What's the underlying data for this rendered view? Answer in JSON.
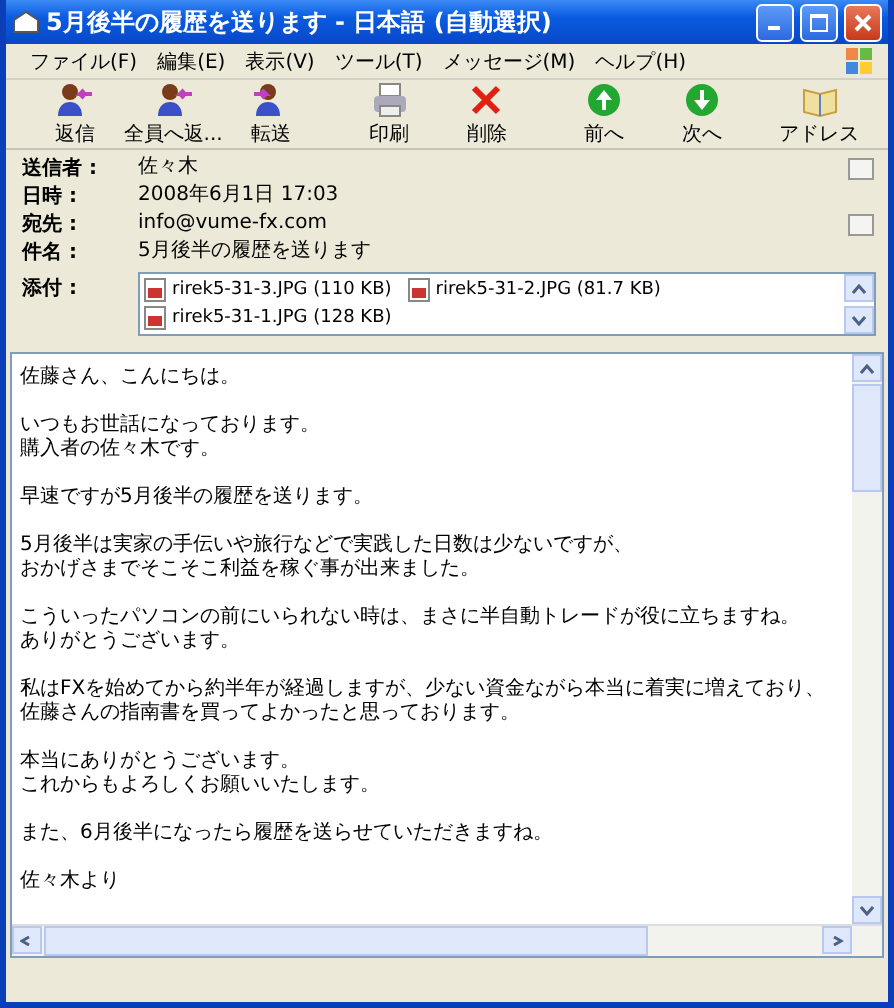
{
  "window": {
    "title": "5月後半の履歴を送ります - 日本語 (自動選択)"
  },
  "menu": [
    "ファイル(F)",
    "編集(E)",
    "表示(V)",
    "ツール(T)",
    "メッセージ(M)",
    "ヘルプ(H)"
  ],
  "toolbar": [
    {
      "kind": "reply",
      "label": "返信"
    },
    {
      "kind": "reply-all",
      "label": "全員へ返..."
    },
    {
      "kind": "forward",
      "label": "転送"
    },
    {
      "kind": "print",
      "label": "印刷"
    },
    {
      "kind": "delete",
      "label": "削除"
    },
    {
      "kind": "previous",
      "label": "前へ"
    },
    {
      "kind": "next",
      "label": "次へ"
    },
    {
      "kind": "address",
      "label": "アドレス"
    }
  ],
  "headers": [
    {
      "label": "送信者 :",
      "value": "佐々木"
    },
    {
      "label": "日時 :",
      "value": "2008年6月1日 17:03"
    },
    {
      "label": "宛先 :",
      "value": "info@vume-fx.com"
    },
    {
      "label": "件名 :",
      "value": "5月後半の履歴を送ります"
    }
  ],
  "attachments": {
    "label": "添付 :",
    "files": [
      "rirek5-31-3.JPG (110 KB)",
      "rirek5-31-2.JPG (81.7 KB)",
      "rirek5-31-1.JPG (128 KB)"
    ]
  },
  "body": [
    [
      "佐藤さん、こんにちは。"
    ],
    [
      "いつもお世話になっております。",
      "購入者の佐々木です。"
    ],
    [
      "早速ですが5月後半の履歴を送ります。"
    ],
    [
      "5月後半は実家の手伝いや旅行などで実践した日数は少ないですが、",
      "おかげさまでそこそこ利益を稼ぐ事が出来ました。"
    ],
    [
      "こういったパソコンの前にいられない時は、まさに半自動トレードが役に立ちますね。",
      "ありがとうございます。"
    ],
    [
      "私はFXを始めてから約半年が経過しますが、少ない資金ながら本当に着実に増えており、",
      "佐藤さんの指南書を買ってよかったと思っております。"
    ],
    [
      "本当にありがとうございます。",
      "これからもよろしくお願いいたします。"
    ],
    [
      "また、6月後半になったら履歴を送らせていただきますね。"
    ],
    [
      "佐々木より"
    ]
  ]
}
